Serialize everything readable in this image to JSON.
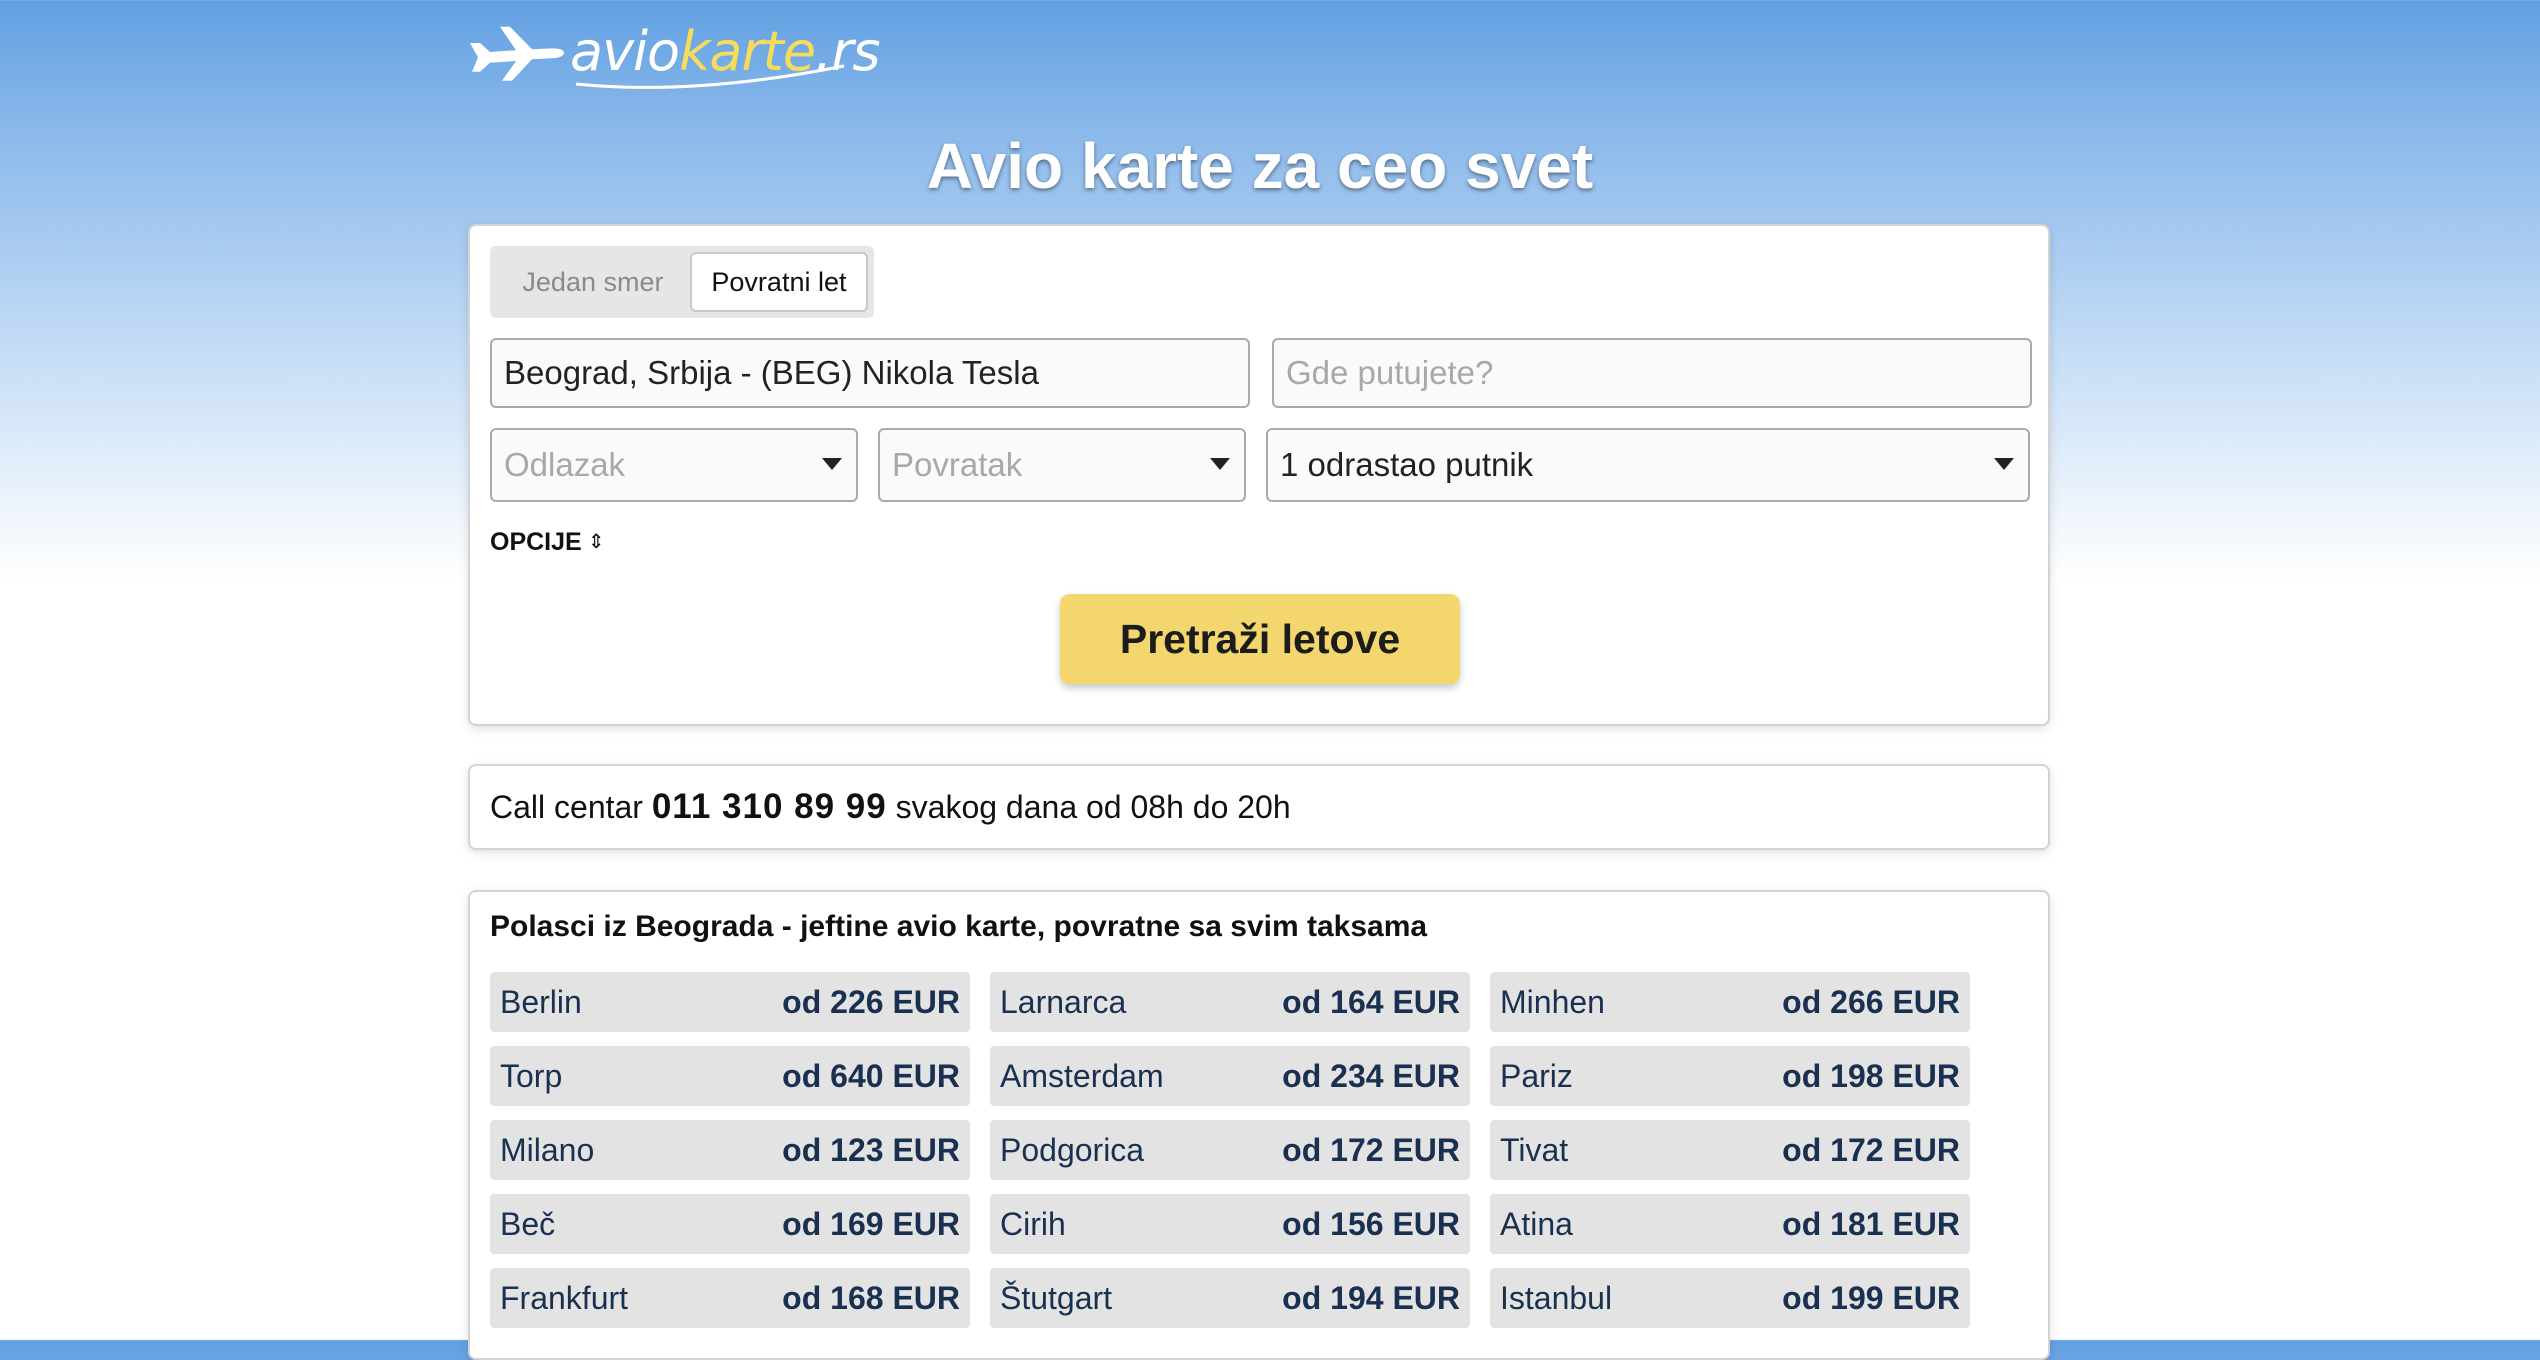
{
  "logo": {
    "part1": "avio",
    "part2": "karte",
    "part3": ".rs",
    "colors": {
      "white": "#ffffff",
      "yellow": "#f6dc5a"
    }
  },
  "hero": {
    "title": "Avio karte za ceo svet"
  },
  "search": {
    "trip_types": {
      "one_way": "Jedan smer",
      "round_trip": "Povratni let",
      "selected": "round_trip"
    },
    "origin_value": "Beograd, Srbija - (BEG) Nikola Tesla",
    "destination_placeholder": "Gde putujete?",
    "departure_placeholder": "Odlazak",
    "return_placeholder": "Povratak",
    "passengers_value": "1 odrastao putnik",
    "options_label": "OPCIJE",
    "options_icon": "chevron-updown-icon",
    "search_button": "Pretraži letove",
    "button_color": "#f3d76e"
  },
  "call_center": {
    "prefix": "Call centar",
    "phone": "011 310 89 99",
    "suffix": "svakog dana od 08h do 20h"
  },
  "routes": {
    "title": "Polasci iz Beograda - jeftine avio karte, povratne sa svim taksama",
    "items": [
      {
        "city": "Berlin",
        "price": "od 226 EUR"
      },
      {
        "city": "Larnarca",
        "price": "od 164 EUR"
      },
      {
        "city": "Minhen",
        "price": "od 266 EUR"
      },
      {
        "city": "Torp",
        "price": "od 640 EUR"
      },
      {
        "city": "Amsterdam",
        "price": "od 234 EUR"
      },
      {
        "city": "Pariz",
        "price": "od 198 EUR"
      },
      {
        "city": "Milano",
        "price": "od 123 EUR"
      },
      {
        "city": "Podgorica",
        "price": "od 172 EUR"
      },
      {
        "city": "Tivat",
        "price": "od 172 EUR"
      },
      {
        "city": "Beč",
        "price": "od 169 EUR"
      },
      {
        "city": "Cirih",
        "price": "od 156 EUR"
      },
      {
        "city": "Atina",
        "price": "od 181 EUR"
      },
      {
        "city": "Frankfurt",
        "price": "od 168 EUR"
      },
      {
        "city": "Štutgart",
        "price": "od 194 EUR"
      },
      {
        "city": "Istanbul",
        "price": "od 199 EUR"
      }
    ]
  }
}
